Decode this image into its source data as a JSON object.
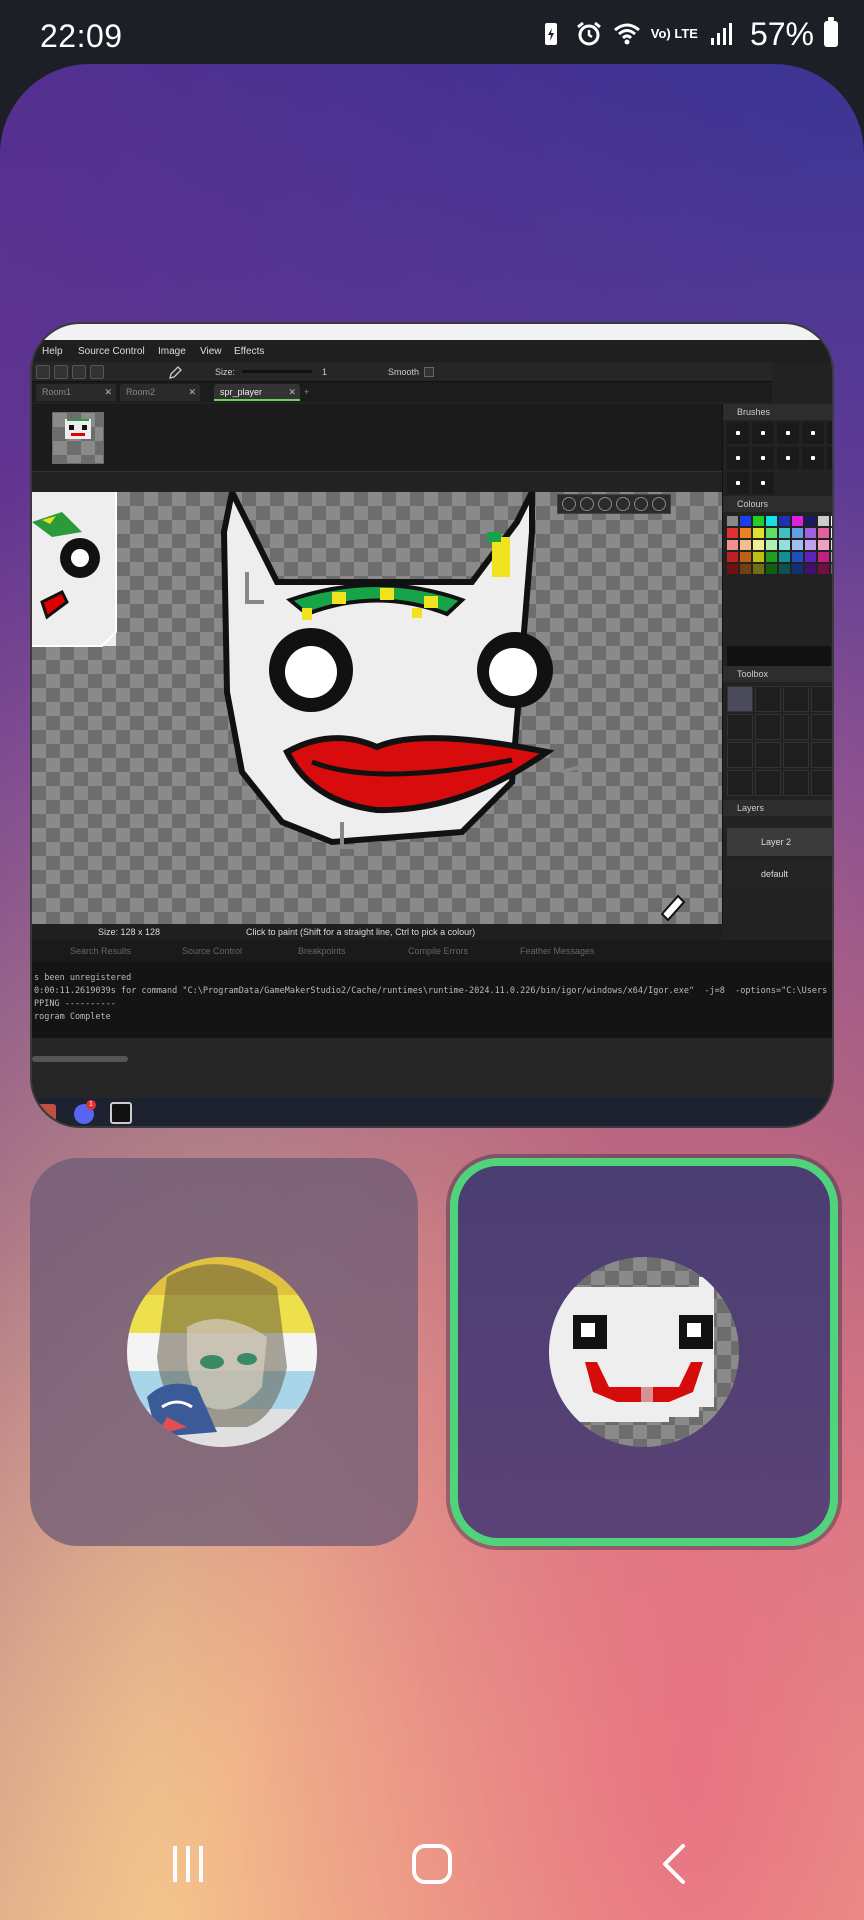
{
  "status_bar": {
    "time": "22:09",
    "network": "Vo) LTE",
    "battery": "57%"
  },
  "window_preview": {
    "menu": [
      "Help",
      "Source Control",
      "Image",
      "View",
      "Effects"
    ],
    "toolbar": {
      "size_label": "Size:",
      "size_value": "1",
      "smooth_label": "Smooth"
    },
    "tabs": [
      "Room1",
      "Room2",
      "spr_player"
    ],
    "active_tab": "spr_player",
    "panels": {
      "brushes": "Brushes",
      "colours": "Colours",
      "toolbox": "Toolbox",
      "layers": "Layers"
    },
    "layers": [
      "Layer 2",
      "default"
    ],
    "canvas_size": "Size: 128 x 128",
    "canvas_hint": "Click to paint (Shift for a straight line, Ctrl to pick a colour)",
    "output_tabs": [
      "Search Results",
      "Source Control",
      "Breakpoints",
      "Compile Errors",
      "Feather Messages"
    ],
    "output_lines": [
      "s been unregistered",
      "0:00:11.2619039s for command \"C:\\ProgramData/GameMakerStudio2/Cache/runtimes\\runtime-2024.11.0.226/bin/igor/windows/x64/Igor.exe\"  -j=8  -options=\"C:\\Users",
      "PPING ----------",
      "rogram Complete"
    ],
    "taskbar_badge": "1"
  },
  "colors": {
    "selected_border": "#4fd47c",
    "status_bg": "#1d1f27"
  },
  "profiles": [
    {
      "icon": "anime-avatar-icon"
    },
    {
      "icon": "pixel-clown-avatar-icon",
      "selected": true
    }
  ],
  "nav": [
    "recents-icon",
    "home-icon",
    "back-icon"
  ]
}
